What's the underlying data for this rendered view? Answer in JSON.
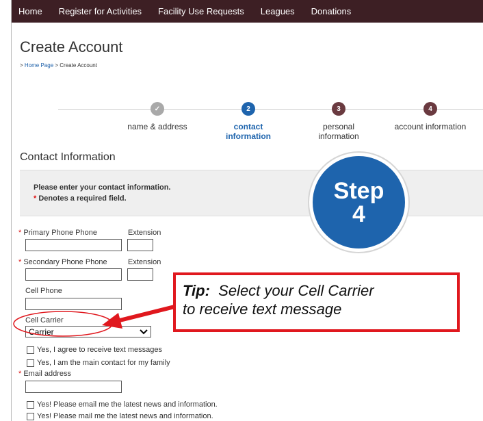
{
  "nav": {
    "items": [
      "Home",
      "Register for Activities",
      "Facility Use Requests",
      "Leagues",
      "Donations"
    ]
  },
  "page_title": "Create Account",
  "breadcrumb": {
    "prefix": "> ",
    "home": "Home Page",
    "sep": " > ",
    "current": "Create Account"
  },
  "steps": [
    {
      "marker": "✓",
      "label": "name & address",
      "state": "completed"
    },
    {
      "marker": "2",
      "label": "contact information",
      "state": "active"
    },
    {
      "marker": "3",
      "label": "personal information",
      "state": "upcoming"
    },
    {
      "marker": "4",
      "label": "account information",
      "state": "upcoming"
    }
  ],
  "section_title": "Contact Information",
  "info": {
    "line1": "Please enter your contact information.",
    "required_mark": "*",
    "line2": " Denotes a required field."
  },
  "form": {
    "primary_phone_label": "Primary Phone Phone",
    "extension_label": "Extension",
    "secondary_phone_label": "Secondary Phone Phone",
    "cell_phone_label": "Cell Phone",
    "cell_carrier_label": "Cell Carrier",
    "carrier_selected": "Carrier",
    "agree_text_label": "Yes, I agree to receive text messages",
    "main_contact_label": "Yes, I am the main contact for my family",
    "email_label": "Email address",
    "email_news_label": "Yes! Please email me the latest news and information.",
    "mail_news_label": "Yes! Please mail me the latest news and information."
  },
  "overlay": {
    "badge_line1": "Step",
    "badge_line2": "4",
    "tip_label": "Tip:",
    "tip_line1": "  Select your Cell Carrier",
    "tip_line2": "to receive text message"
  },
  "colors": {
    "nav_bg": "#3d1f24",
    "active_step": "#1e64ad",
    "upcoming_step": "#6a3a40",
    "completed_step": "#a9a9a9",
    "annotation_red": "#e0181e",
    "badge_blue": "#1e64ad"
  }
}
